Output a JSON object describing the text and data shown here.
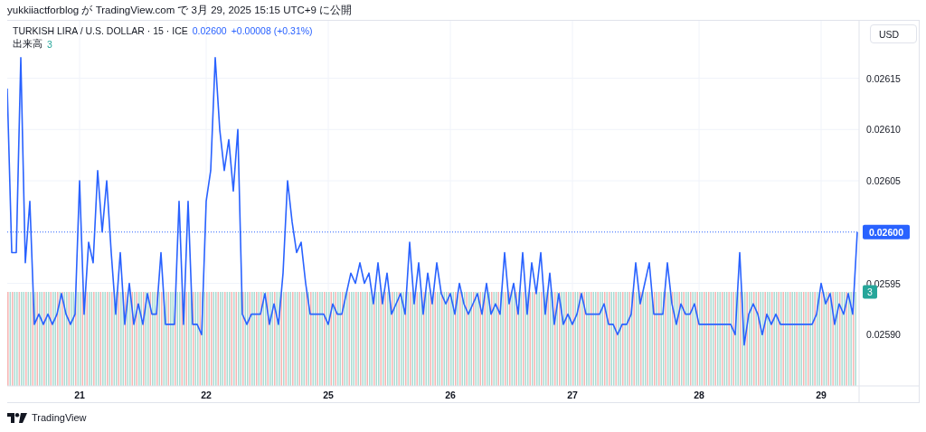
{
  "header": {
    "publisher": "yukkiiactforblog が TradingView.com で 3月 29, 2025 15:15 UTC+9 に公開"
  },
  "legend": {
    "symbol": "TURKISH LIRA / U.S. DOLLAR · 15 · ICE",
    "price": "0.02600",
    "change": "+0.00008 (+0.31%)",
    "volume_label": "出来高",
    "volume_value": "3"
  },
  "currency_button": "USD",
  "volume_marker": "3",
  "chart_data": {
    "type": "line",
    "grid": true,
    "ylim": [
      0.02585,
      0.026206
    ],
    "categories": [
      null,
      null,
      null,
      null,
      null,
      null,
      null,
      null,
      null,
      null,
      null,
      null,
      null,
      null,
      null,
      null,
      "21",
      null,
      null,
      null,
      null,
      null,
      null,
      null,
      null,
      null,
      null,
      null,
      null,
      null,
      null,
      null,
      null,
      null,
      null,
      null,
      null,
      null,
      null,
      null,
      null,
      null,
      null,
      null,
      "22",
      null,
      null,
      null,
      null,
      null,
      null,
      null,
      null,
      null,
      null,
      null,
      null,
      null,
      null,
      null,
      null,
      null,
      null,
      null,
      null,
      null,
      null,
      null,
      null,
      null,
      null,
      "25",
      null,
      null,
      null,
      null,
      null,
      null,
      null,
      null,
      null,
      null,
      null,
      null,
      null,
      null,
      null,
      null,
      null,
      null,
      null,
      null,
      null,
      null,
      null,
      null,
      null,
      null,
      "26",
      null,
      null,
      null,
      null,
      null,
      null,
      null,
      null,
      null,
      null,
      null,
      null,
      null,
      null,
      null,
      null,
      null,
      null,
      null,
      null,
      null,
      null,
      null,
      null,
      null,
      null,
      "27",
      null,
      null,
      null,
      null,
      null,
      null,
      null,
      null,
      null,
      null,
      null,
      null,
      null,
      null,
      null,
      null,
      null,
      null,
      null,
      null,
      null,
      null,
      null,
      null,
      null,
      null,
      null,
      "28",
      null,
      null,
      null,
      null,
      null,
      null,
      null,
      null,
      null,
      null,
      null,
      null,
      null,
      null,
      null,
      null,
      null,
      null,
      null,
      null,
      null,
      null,
      null,
      null,
      null,
      null,
      "29",
      null,
      null,
      null,
      null,
      null,
      null,
      null,
      null
    ],
    "ref_lines": [
      {
        "value": 0.026,
        "axis": "y",
        "color": "#2962ff",
        "label": "0.02600"
      }
    ],
    "yticks": [
      {
        "value": 0.0259,
        "label": "0.02590"
      },
      {
        "value": 0.02595,
        "label": "0.02595"
      },
      {
        "value": 0.02605,
        "label": "0.02605"
      },
      {
        "value": 0.0261,
        "label": "0.02610"
      },
      {
        "value": 0.02615,
        "label": "0.02615"
      }
    ],
    "series": [
      {
        "color": "#2962ff",
        "values": [
          0.02614,
          0.02598,
          0.02598,
          0.02617,
          0.02597,
          0.02603,
          0.02591,
          0.02592,
          0.02591,
          0.02592,
          0.02591,
          0.02592,
          0.02594,
          0.02592,
          0.02591,
          0.02592,
          0.02605,
          0.02592,
          0.02599,
          0.02597,
          0.02606,
          0.026,
          0.02605,
          0.02598,
          0.02592,
          0.02598,
          0.02591,
          0.02595,
          0.02591,
          0.02593,
          0.02591,
          0.02594,
          0.02592,
          0.02592,
          0.02598,
          0.02591,
          0.02591,
          0.02591,
          0.02603,
          0.02591,
          0.02603,
          0.02591,
          0.02591,
          0.0259,
          0.02603,
          0.02606,
          0.02617,
          0.0261,
          0.02606,
          0.02609,
          0.02604,
          0.0261,
          0.02592,
          0.02591,
          0.02592,
          0.02592,
          0.02592,
          0.02594,
          0.02591,
          0.02593,
          0.02591,
          0.02596,
          0.02605,
          0.02601,
          0.02598,
          0.02599,
          0.02595,
          0.02592,
          0.02592,
          0.02592,
          0.02592,
          0.02591,
          0.02593,
          0.02592,
          0.02592,
          0.02594,
          0.02596,
          0.02595,
          0.02597,
          0.02595,
          0.02596,
          0.02593,
          0.02597,
          0.02593,
          0.02596,
          0.02592,
          0.02593,
          0.02594,
          0.02592,
          0.02599,
          0.02593,
          0.02597,
          0.02592,
          0.02596,
          0.02593,
          0.02597,
          0.02594,
          0.02593,
          0.02594,
          0.02592,
          0.02595,
          0.02593,
          0.02592,
          0.02593,
          0.02594,
          0.02592,
          0.02595,
          0.02592,
          0.02593,
          0.02592,
          0.02598,
          0.02593,
          0.02595,
          0.02592,
          0.02598,
          0.02592,
          0.02597,
          0.02594,
          0.02598,
          0.02592,
          0.02596,
          0.02591,
          0.02594,
          0.02591,
          0.02592,
          0.02591,
          0.02592,
          0.02594,
          0.02592,
          0.02592,
          0.02592,
          0.02592,
          0.02593,
          0.02591,
          0.02591,
          0.0259,
          0.02591,
          0.02591,
          0.02592,
          0.02597,
          0.02593,
          0.02595,
          0.02597,
          0.02592,
          0.02592,
          0.02592,
          0.02597,
          0.02593,
          0.02591,
          0.02593,
          0.02592,
          0.02592,
          0.02593,
          0.02591,
          0.02591,
          0.02591,
          0.02591,
          0.02591,
          0.02591,
          0.02591,
          0.02591,
          0.0259,
          0.02598,
          0.02589,
          0.02592,
          0.02593,
          0.02592,
          0.0259,
          0.02592,
          0.02591,
          0.02592,
          0.02591,
          0.02591,
          0.02591,
          0.02591,
          0.02591,
          0.02591,
          0.02591,
          0.02591,
          0.02592,
          0.02595,
          0.02593,
          0.02594,
          0.02591,
          0.02593,
          0.02592,
          0.02594,
          0.02592,
          0.026
        ]
      }
    ]
  },
  "footer": {
    "brand": "TradingView"
  }
}
